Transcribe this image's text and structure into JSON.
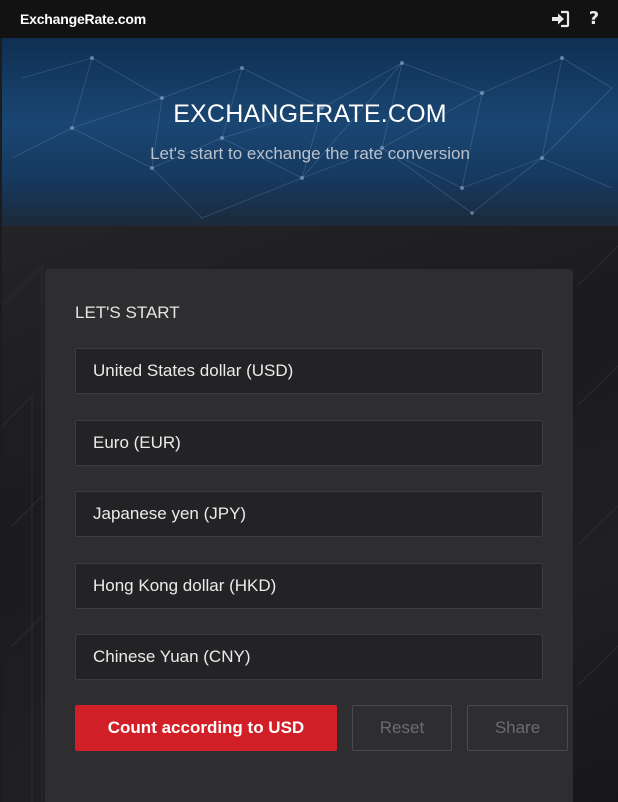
{
  "topbar": {
    "brand": "ExchangeRate.com",
    "icons": [
      "sign-in-icon",
      "help-icon"
    ],
    "help_glyph": "?"
  },
  "hero": {
    "title": "EXCHANGERATE.COM",
    "subtitle": "Let's start to exchange the rate conversion"
  },
  "form": {
    "heading": "LET'S START",
    "currencies": [
      "United States dollar (USD)",
      "Euro (EUR)",
      "Japanese yen (JPY)",
      "Hong Kong dollar (HKD)",
      "Chinese Yuan (CNY)"
    ],
    "count_label": "Count according to USD",
    "reset_label": "Reset",
    "share_label": "Share"
  },
  "colors": {
    "accent": "#d01f27",
    "topbar": "#121212",
    "card": "#2e2e31",
    "hero": "#1a4673"
  }
}
